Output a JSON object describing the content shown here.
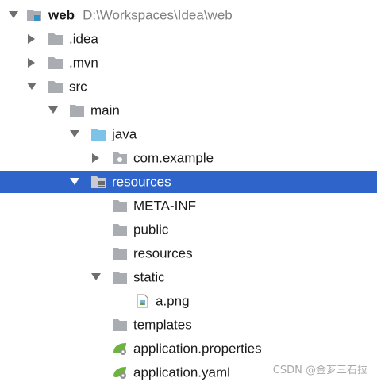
{
  "tree": {
    "root": {
      "name": "web",
      "path": "D:\\Workspaces\\Idea\\web"
    },
    "items": [
      {
        "label": ".idea"
      },
      {
        "label": ".mvn"
      },
      {
        "label": "src"
      },
      {
        "label": "main"
      },
      {
        "label": "java"
      },
      {
        "label": "com.example"
      },
      {
        "label": "resources"
      },
      {
        "label": "META-INF"
      },
      {
        "label": "public"
      },
      {
        "label": "resources"
      },
      {
        "label": "static"
      },
      {
        "label": "a.png"
      },
      {
        "label": "templates"
      },
      {
        "label": "application.properties"
      },
      {
        "label": "application.yaml"
      }
    ]
  },
  "selection": {
    "selected_label": "resources"
  },
  "colors": {
    "selection": "#2f65ca",
    "folder": "#a9adb1",
    "source_folder": "#7dc3e8",
    "spring_leaf": "#6db33f"
  },
  "watermark": "CSDN @金芗三石拉"
}
